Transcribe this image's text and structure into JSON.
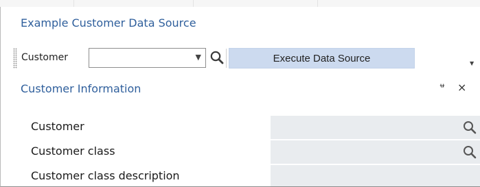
{
  "header": {
    "source_title": "Example Customer Data Source"
  },
  "toolbar": {
    "parameter_label": "Customer",
    "customer_value": "",
    "execute_label": "Execute Data Source"
  },
  "panel": {
    "title": "Customer Information",
    "pin_glyph": "ᶶ",
    "close_glyph": "×",
    "fields": [
      {
        "label": "Customer",
        "value": "",
        "has_lookup": true
      },
      {
        "label": "Customer class",
        "value": "",
        "has_lookup": true
      },
      {
        "label": "Customer class description",
        "value": "",
        "has_lookup": false
      }
    ]
  },
  "icons": {
    "search": "magnifier-icon",
    "dropdown": "chevron-down-icon",
    "pin": "pin-icon",
    "close": "close-icon"
  },
  "colors": {
    "title_blue": "#2f5f9c",
    "execute_button_bg": "#ccdaef",
    "field_bg": "#e9ecef"
  }
}
